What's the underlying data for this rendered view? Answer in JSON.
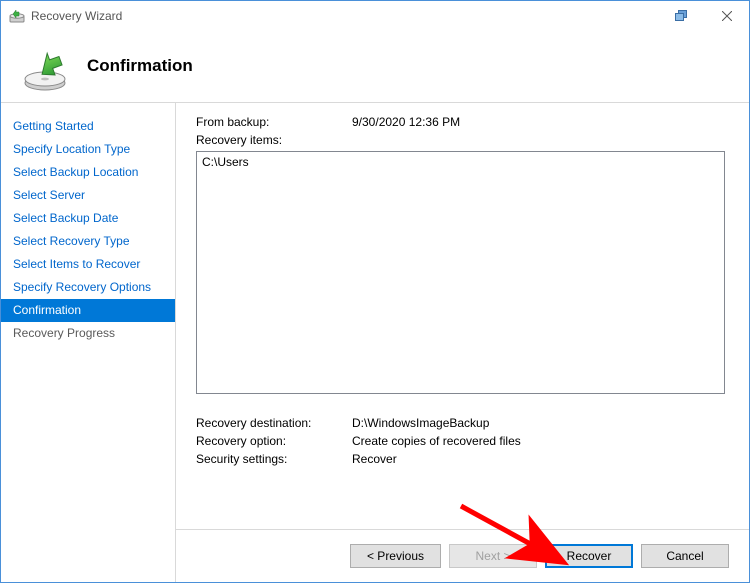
{
  "window": {
    "title": "Recovery Wizard"
  },
  "header": {
    "title": "Confirmation"
  },
  "sidebar": {
    "items": [
      {
        "label": "Getting Started",
        "state": "done"
      },
      {
        "label": "Specify Location Type",
        "state": "done"
      },
      {
        "label": "Select Backup Location",
        "state": "done"
      },
      {
        "label": "Select Server",
        "state": "done"
      },
      {
        "label": "Select Backup Date",
        "state": "done"
      },
      {
        "label": "Select Recovery Type",
        "state": "done"
      },
      {
        "label": "Select Items to Recover",
        "state": "done"
      },
      {
        "label": "Specify Recovery Options",
        "state": "done"
      },
      {
        "label": "Confirmation",
        "state": "selected"
      },
      {
        "label": "Recovery Progress",
        "state": "after"
      }
    ]
  },
  "main": {
    "from_backup_label": "From backup:",
    "from_backup_value": "9/30/2020 12:36 PM",
    "recovery_items_label": "Recovery items:",
    "recovery_items": [
      "C:\\Users"
    ],
    "recovery_destination_label": "Recovery destination:",
    "recovery_destination_value": "D:\\WindowsImageBackup",
    "recovery_option_label": "Recovery option:",
    "recovery_option_value": "Create copies of recovered files",
    "security_settings_label": "Security settings:",
    "security_settings_value": "Recover"
  },
  "buttons": {
    "previous": "< Previous",
    "next": "Next >",
    "recover": "Recover",
    "cancel": "Cancel"
  }
}
